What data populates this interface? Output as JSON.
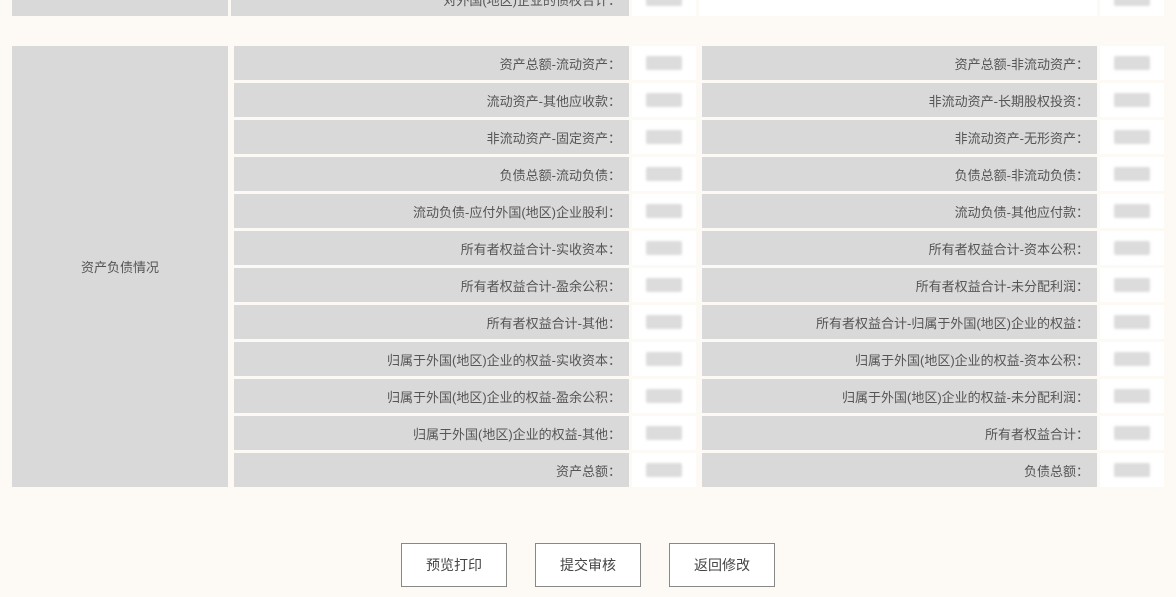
{
  "top_section": {
    "label": "对外国(地区)企业的债权合计："
  },
  "main_section": {
    "category": "资产负债情况",
    "rows": [
      {
        "left": "资产总额-流动资产：",
        "right": "资产总额-非流动资产："
      },
      {
        "left": "流动资产-其他应收款：",
        "right": "非流动资产-长期股权投资："
      },
      {
        "left": "非流动资产-固定资产：",
        "right": "非流动资产-无形资产："
      },
      {
        "left": "负债总额-流动负债：",
        "right": "负债总额-非流动负债："
      },
      {
        "left": "流动负债-应付外国(地区)企业股利：",
        "right": "流动负债-其他应付款："
      },
      {
        "left": "所有者权益合计-实收资本：",
        "right": "所有者权益合计-资本公积："
      },
      {
        "left": "所有者权益合计-盈余公积：",
        "right": "所有者权益合计-未分配利润："
      },
      {
        "left": "所有者权益合计-其他：",
        "right": "所有者权益合计-归属于外国(地区)企业的权益："
      },
      {
        "left": "归属于外国(地区)企业的权益-实收资本：",
        "right": "归属于外国(地区)企业的权益-资本公积："
      },
      {
        "left": "归属于外国(地区)企业的权益-盈余公积：",
        "right": "归属于外国(地区)企业的权益-未分配利润："
      },
      {
        "left": "归属于外国(地区)企业的权益-其他：",
        "right": "所有者权益合计："
      },
      {
        "left": "资产总额：",
        "right": "负债总额："
      }
    ]
  },
  "buttons": {
    "preview": "预览打印",
    "submit": "提交审核",
    "back": "返回修改"
  }
}
